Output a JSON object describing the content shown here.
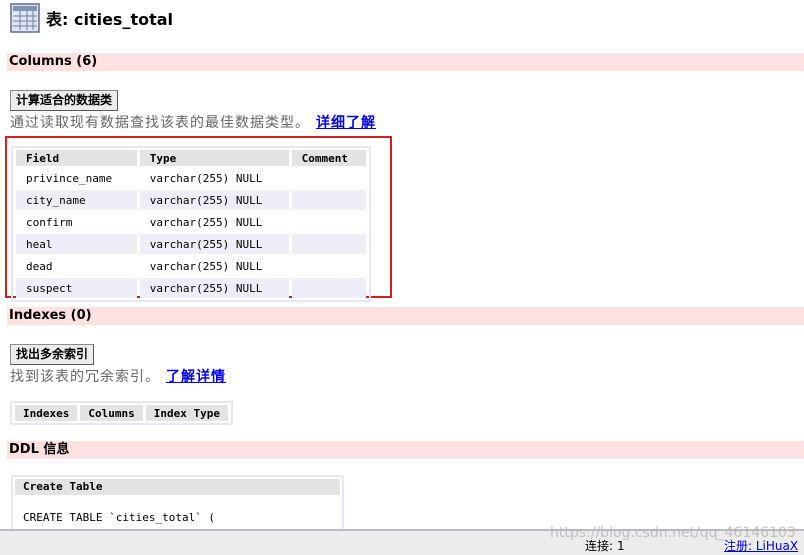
{
  "header": {
    "title": "表: cities_total",
    "icon": "table-grid-icon"
  },
  "columns_section": {
    "heading": "Columns (6)",
    "button_label": "计算适合的数据类",
    "hint_text": "通过读取现有数据查找该表的最佳数据类型。",
    "hint_link": "详细了解",
    "table": {
      "headers": [
        "Field",
        "Type",
        "Comment"
      ],
      "rows": [
        {
          "field": "privince_name",
          "type": "varchar(255) NULL",
          "comment": ""
        },
        {
          "field": "city_name",
          "type": "varchar(255) NULL",
          "comment": ""
        },
        {
          "field": "confirm",
          "type": "varchar(255) NULL",
          "comment": ""
        },
        {
          "field": "heal",
          "type": "varchar(255) NULL",
          "comment": ""
        },
        {
          "field": "dead",
          "type": "varchar(255) NULL",
          "comment": ""
        },
        {
          "field": "suspect",
          "type": "varchar(255) NULL",
          "comment": ""
        }
      ]
    }
  },
  "indexes_section": {
    "heading": "Indexes (0)",
    "button_label": "找出多余索引",
    "hint_text": "找到该表的冗余索引。",
    "hint_link": "了解详情",
    "headers": [
      "Indexes",
      "Columns",
      "Index Type"
    ]
  },
  "ddl_section": {
    "heading": "DDL 信息",
    "box_header": "Create Table",
    "code_first_line": "CREATE TABLE `cities_total` ("
  },
  "status_bar": {
    "connection_label": "连接:",
    "connection_value": "1",
    "register_text": "注册: LiHuaX"
  },
  "watermark": "https://blog.csdn.net/qq_46146103",
  "colors": {
    "section_bg": "#ffe1e1",
    "highlight_border": "#cc2222",
    "link": "#0000ee"
  }
}
